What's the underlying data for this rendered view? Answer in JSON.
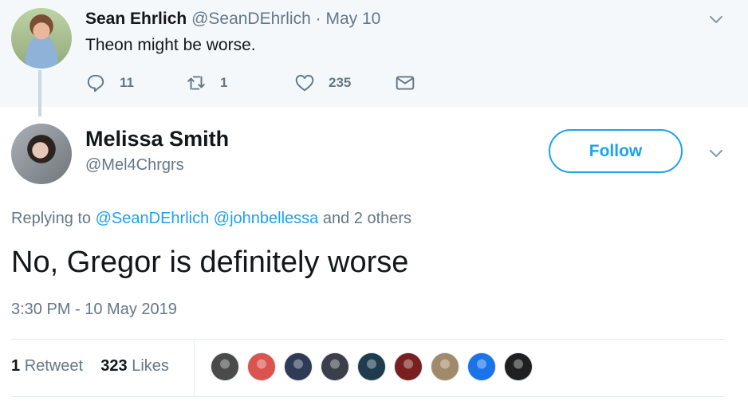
{
  "parent_tweet": {
    "author_name": "Sean Ehrlich",
    "author_handle": "@SeanDEhrlich",
    "separator": "·",
    "date": "May 10",
    "text": "Theon might be worse.",
    "actions": {
      "reply_count": "11",
      "retweet_count": "1",
      "like_count": "235"
    }
  },
  "main_tweet": {
    "author_name": "Melissa Smith",
    "author_handle": "@Mel4Chrgrs",
    "follow_label": "Follow",
    "replying_prefix": "Replying to",
    "replying_mentions": [
      "@SeanDEhrlich",
      "@johnbellessa"
    ],
    "replying_suffix": "and 2 others",
    "text": "No, Gregor is definitely worse",
    "timestamp": "3:30 PM - 10 May 2019",
    "stats": {
      "retweets_count": "1",
      "retweets_label": "Retweet",
      "likes_count": "323",
      "likes_label": "Likes"
    }
  },
  "colors": {
    "accent": "#1da1f2",
    "muted": "#657786",
    "parent_bg": "#f5f8fa",
    "liker_avatars": [
      "#4a4a4a",
      "#d9534f",
      "#2e3a56",
      "#3b3f4a",
      "#1f3b4d",
      "#7a1f1f",
      "#a08a6a",
      "#1a73e8",
      "#202020"
    ]
  }
}
